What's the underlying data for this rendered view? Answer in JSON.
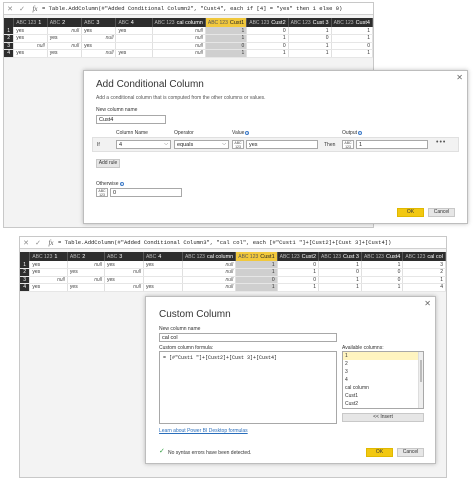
{
  "top": {
    "formula": "= Table.AddColumn(#\"Added Conditional Column2\", \"Cust4\", each if [4] = \"yes\" then 1 else 0)",
    "columns": [
      {
        "type": "ABC 123",
        "name": "1"
      },
      {
        "type": "ABC",
        "name": "2"
      },
      {
        "type": "ABC",
        "name": "3"
      },
      {
        "type": "ABC",
        "name": "4"
      },
      {
        "type": "ABC 123",
        "name": "cal column"
      },
      {
        "type": "ABC 123",
        "name": "Cust1"
      },
      {
        "type": "ABC 123",
        "name": "Cust2"
      },
      {
        "type": "ABC 123",
        "name": "Cust 3"
      },
      {
        "type": "ABC 123",
        "name": "Cust4"
      }
    ],
    "rows": [
      {
        "n": "1",
        "c1": "yes",
        "c2": "null",
        "c3": "yes",
        "c4": "yes",
        "cal": "null",
        "k1": "1",
        "k2": "0",
        "k3": "1",
        "k4": "1"
      },
      {
        "n": "2",
        "c1": "yes",
        "c2": "yes",
        "c3": "null",
        "c4": "",
        "cal": "null",
        "k1": "1",
        "k2": "1",
        "k3": "0",
        "k4": "1"
      },
      {
        "n": "3",
        "c1": "null",
        "c2": "null",
        "c3": "yes",
        "c4": "",
        "cal": "null",
        "k1": "0",
        "k2": "0",
        "k3": "1",
        "k4": "0"
      },
      {
        "n": "4",
        "c1": "yes",
        "c2": "yes",
        "c3": "null",
        "c4": "yes",
        "cal": "null",
        "k1": "1",
        "k2": "1",
        "k3": "1",
        "k4": "1"
      }
    ]
  },
  "conditional": {
    "title": "Add Conditional Column",
    "description": "Add a conditional column that is computed from the other columns or values.",
    "new_col_label": "New column name",
    "new_col_value": "Cust4",
    "col_name_header": "Column Name",
    "operator_header": "Operator",
    "value_header": "Value",
    "output_header": "Output",
    "if_label": "If",
    "col_value": "4",
    "operator_value": "equals",
    "value_type": "ABC 123",
    "value_value": "yes",
    "then_label": "Then",
    "output_type": "ABC 123",
    "output_value": "1",
    "more": "•••",
    "add_rule": "Add rule",
    "otherwise_label": "Otherwise",
    "otherwise_type": "ABC 123",
    "otherwise_value": "0",
    "ok": "OK",
    "cancel": "Cancel",
    "info": "i"
  },
  "bottom": {
    "formula": "= Table.AddColumn(#\"Added Conditional Column3\", \"cal col\", each [#\"Cust1 \"]+[Cust2]+[Cust 3]+[Cust4])",
    "columns": [
      {
        "type": "ABC 123",
        "name": "1"
      },
      {
        "type": "ABC",
        "name": "2"
      },
      {
        "type": "ABC",
        "name": "3"
      },
      {
        "type": "ABC",
        "name": "4"
      },
      {
        "type": "ABC 123",
        "name": "cal column"
      },
      {
        "type": "ABC 123",
        "name": "Cust1"
      },
      {
        "type": "ABC 123",
        "name": "Cust2"
      },
      {
        "type": "ABC 123",
        "name": "Cust 3"
      },
      {
        "type": "ABC 123",
        "name": "Cust4"
      },
      {
        "type": "ABC 123",
        "name": "cal col"
      }
    ],
    "rows": [
      {
        "n": "1",
        "c1": "yes",
        "c2": "null",
        "c3": "yes",
        "c4": "yes",
        "cal": "null",
        "k1": "1",
        "k2": "0",
        "k3": "1",
        "k4": "1",
        "cc": "3"
      },
      {
        "n": "2",
        "c1": "yes",
        "c2": "yes",
        "c3": "null",
        "c4": "",
        "cal": "null",
        "k1": "1",
        "k2": "1",
        "k3": "0",
        "k4": "0",
        "cc": "2"
      },
      {
        "n": "3",
        "c1": "null",
        "c2": "null",
        "c3": "yes",
        "c4": "",
        "cal": "null",
        "k1": "0",
        "k2": "0",
        "k3": "1",
        "k4": "0",
        "cc": "1"
      },
      {
        "n": "4",
        "c1": "yes",
        "c2": "yes",
        "c3": "null",
        "c4": "yes",
        "cal": "null",
        "k1": "1",
        "k2": "1",
        "k3": "1",
        "k4": "1",
        "cc": "4"
      }
    ]
  },
  "custom": {
    "title": "Custom Column",
    "new_col_label": "New column name",
    "new_col_value": "cal col",
    "formula_label": "Custom column formula:",
    "formula_value": "= [#\"Cust1 \"]+[Cust2]+[Cust 3]+[Cust4]",
    "available_label": "Available columns:",
    "available": [
      "1",
      "2",
      "3",
      "4",
      "cal column",
      "Cust1",
      "Cust2"
    ],
    "insert": "<< Insert",
    "learn_link": "Learn about Power BI Desktop formulas",
    "status": "No syntax errors have been detected.",
    "ok": "OK",
    "cancel": "Cancel"
  },
  "icons": {
    "close": "✕",
    "check": "✓",
    "fx": "fx",
    "close_icon_name": "close-icon",
    "check_icon_name": "check-icon"
  },
  "colors": {
    "header_bg": "#2d2d2d",
    "selected_header": "#f1c83c",
    "ok_button": "#f2c811",
    "link": "#2a6ebb"
  }
}
